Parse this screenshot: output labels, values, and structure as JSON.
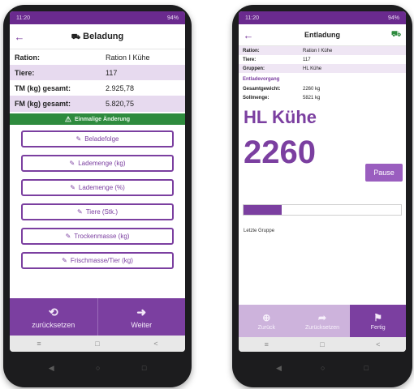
{
  "left": {
    "status": {
      "left": "11:20",
      "right": "94%"
    },
    "title": "Beladung",
    "back_icon": "arrow-left",
    "rows": [
      {
        "label": "Ration:",
        "value": "Ration I Kühe"
      },
      {
        "label": "Tiere:",
        "value": "117"
      },
      {
        "label": "TM (kg) gesamt:",
        "value": "2.925,78"
      },
      {
        "label": "FM (kg) gesamt:",
        "value": "5.820,75"
      }
    ],
    "warning": "Einmalige Änderung",
    "buttons": [
      {
        "label": "Beladefolge"
      },
      {
        "label": "Lademenge (kg)"
      },
      {
        "label": "Lademenge (%)"
      },
      {
        "label": "Tiere (Stk.)"
      },
      {
        "label": "Trockenmasse (kg)"
      },
      {
        "label": "Frischmasse/Tier (kg)"
      }
    ],
    "bottom": [
      {
        "label": "zurücksetzen",
        "icon": "undo-icon"
      },
      {
        "label": "Weiter",
        "icon": "arrow-right-circle-icon"
      }
    ]
  },
  "right": {
    "status": {
      "left": "11:20",
      "right": "94%"
    },
    "title": "Entladung",
    "rows": [
      {
        "label": "Ration:",
        "value": "Ration I Kühe"
      },
      {
        "label": "Tiere:",
        "value": "117"
      },
      {
        "label": "Gruppen:",
        "value": "HL Kühe"
      }
    ],
    "section": "Entladevorgang",
    "detail_rows": [
      {
        "label": "Gesamtgewicht:",
        "value": "2260 kg"
      },
      {
        "label": "Sollmenge:",
        "value": "5821 kg"
      }
    ],
    "group": "HL Kühe",
    "value": "2260",
    "pause": "Pause",
    "progress": 0.24,
    "last_group": "Letzte Gruppe",
    "bottom": [
      {
        "label": "Zurück",
        "icon": "plus-circle-icon"
      },
      {
        "label": "Zurücksetzen",
        "icon": "redo-icon"
      },
      {
        "label": "Fertig",
        "icon": "flag-icon"
      }
    ]
  },
  "colors": {
    "purple": "#7b3fa0",
    "green": "#2e8b3e"
  }
}
